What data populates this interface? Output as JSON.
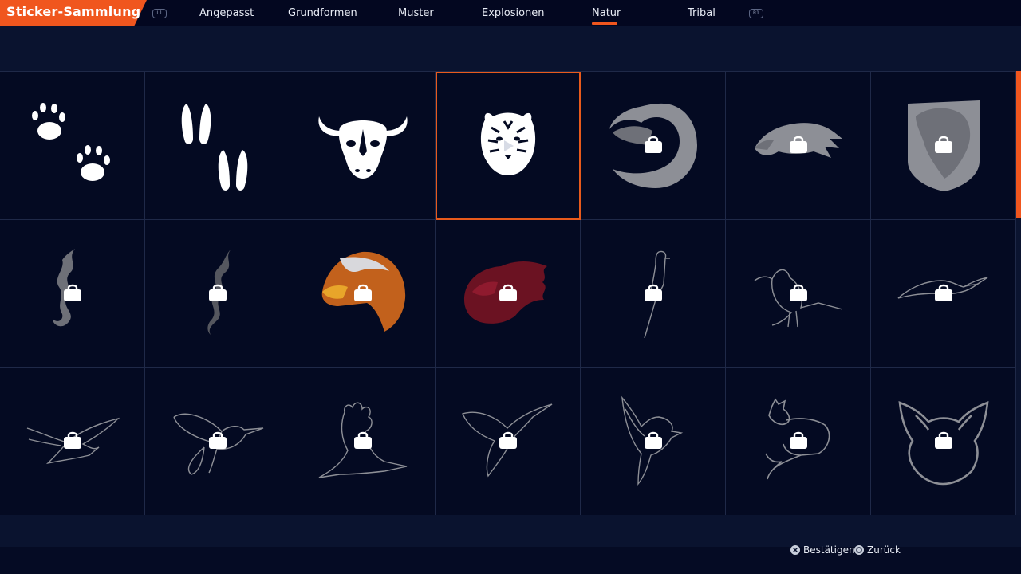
{
  "header": {
    "title": "Sticker-Sammlung",
    "left_bumper": "L1",
    "right_bumper": "R1",
    "tabs": [
      {
        "label": "Angepasst",
        "active": false
      },
      {
        "label": "Grundformen",
        "active": false
      },
      {
        "label": "Muster",
        "active": false
      },
      {
        "label": "Explosionen",
        "active": false
      },
      {
        "label": "Natur",
        "active": true
      },
      {
        "label": "Tribal",
        "active": false
      }
    ],
    "accent_color": "#f0561e"
  },
  "stickers": [
    {
      "icon": "paw-prints-icon",
      "locked": false
    },
    {
      "icon": "hoof-prints-icon",
      "locked": false
    },
    {
      "icon": "bull-head-icon",
      "locked": false
    },
    {
      "icon": "tiger-head-icon",
      "locked": false,
      "selected": true
    },
    {
      "icon": "eagle-circle-icon",
      "locked": true
    },
    {
      "icon": "eagle-head-icon",
      "locked": true
    },
    {
      "icon": "lion-shield-icon",
      "locked": true
    },
    {
      "icon": "tribal-flame-icon",
      "locked": true
    },
    {
      "icon": "tribal-smoke-icon",
      "locked": true
    },
    {
      "icon": "eagle-color-icon",
      "locked": true
    },
    {
      "icon": "red-horse-icon",
      "locked": true
    },
    {
      "icon": "bird-perched-line-icon",
      "locked": true
    },
    {
      "icon": "cardinal-line-icon",
      "locked": true
    },
    {
      "icon": "seagull-line-icon",
      "locked": true
    },
    {
      "icon": "bird-flying-line-icon",
      "locked": true
    },
    {
      "icon": "hummingbird-line-icon",
      "locked": true
    },
    {
      "icon": "eagle-rising-line-icon",
      "locked": true
    },
    {
      "icon": "hummingbird-alt-line-icon",
      "locked": true
    },
    {
      "icon": "dove-line-icon",
      "locked": true
    },
    {
      "icon": "fox-line-icon",
      "locked": true
    },
    {
      "icon": "fox-head-line-icon",
      "locked": true
    }
  ],
  "footer": {
    "confirm_label": "Bestätigen",
    "back_label": "Zurück"
  }
}
